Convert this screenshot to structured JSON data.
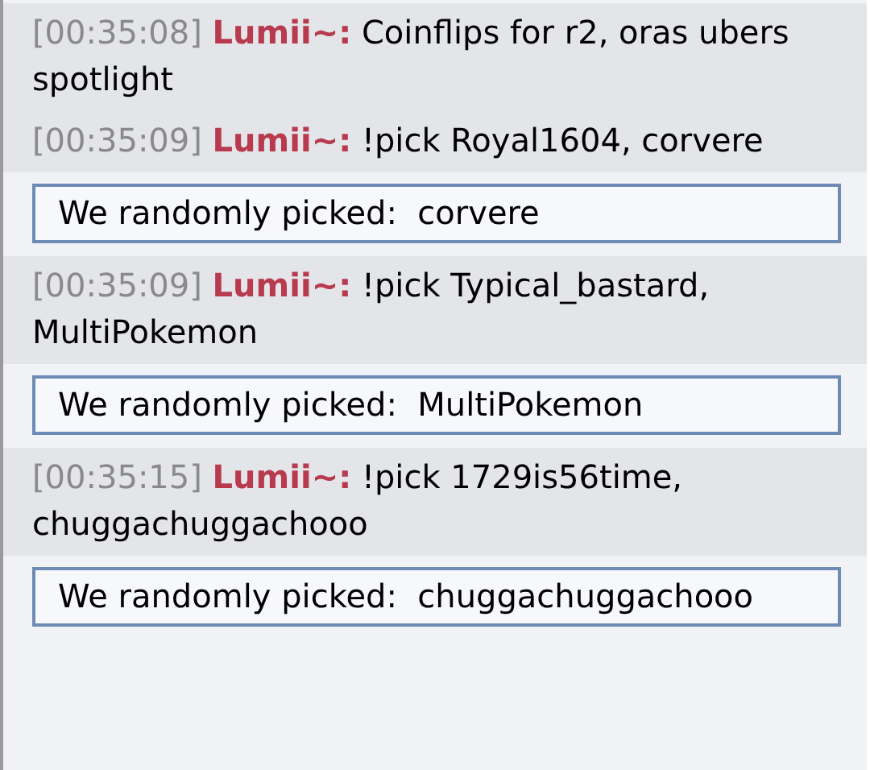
{
  "messages": [
    {
      "kind": "chat",
      "time": "[00:35:08]",
      "user": "Lumii~:",
      "text": "Coinflips for r2, oras ubers spotlight"
    },
    {
      "kind": "chat",
      "time": "[00:35:09]",
      "user": "Lumii~:",
      "text": "!pick Royal1604, corvere"
    },
    {
      "kind": "result",
      "text": "We randomly picked:  corvere"
    },
    {
      "kind": "chat",
      "time": "[00:35:09]",
      "user": "Lumii~:",
      "text": "!pick Typical_bastard, MultiPokemon"
    },
    {
      "kind": "result",
      "text": "We randomly picked:  MultiPokemon"
    },
    {
      "kind": "chat",
      "time": "[00:35:15]",
      "user": "Lumii~:",
      "text": "!pick 1729is56time, chuggachuggachooo"
    },
    {
      "kind": "result",
      "text": "We randomly picked:  chuggachuggachooo"
    }
  ]
}
